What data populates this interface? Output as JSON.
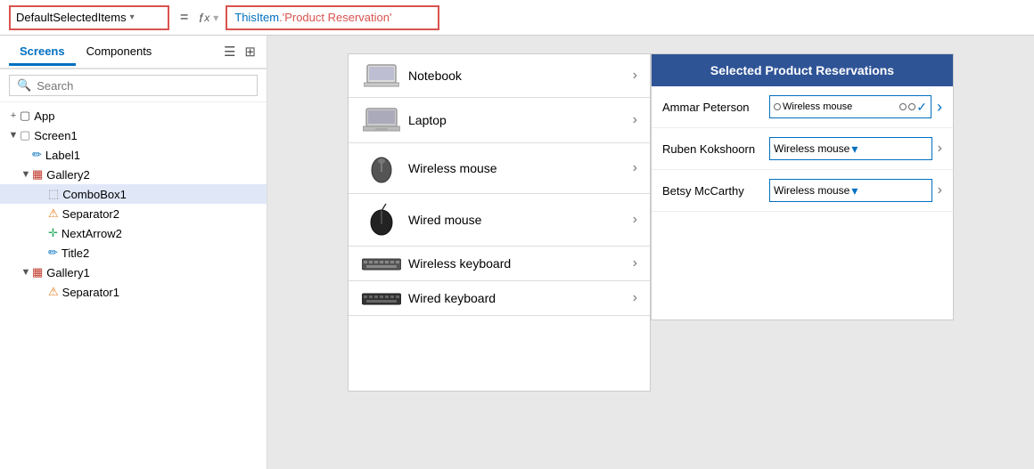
{
  "formulaBar": {
    "dropdownLabel": "DefaultSelectedItems",
    "equals": "=",
    "fx": "fx",
    "formulaText": "ThisItem.'Product Reservation'"
  },
  "sidebar": {
    "tabs": [
      {
        "id": "screens",
        "label": "Screens",
        "active": true
      },
      {
        "id": "components",
        "label": "Components",
        "active": false
      }
    ],
    "searchPlaceholder": "Search",
    "tree": [
      {
        "id": "app",
        "label": "App",
        "indent": 0,
        "expand": "+",
        "iconType": "app"
      },
      {
        "id": "screen1",
        "label": "Screen1",
        "indent": 0,
        "expand": "▲",
        "iconType": "screen"
      },
      {
        "id": "label1",
        "label": "Label1",
        "indent": 1,
        "expand": "",
        "iconType": "label"
      },
      {
        "id": "gallery2",
        "label": "Gallery2",
        "indent": 1,
        "expand": "▲",
        "iconType": "gallery"
      },
      {
        "id": "combobox1",
        "label": "ComboBox1",
        "indent": 2,
        "expand": "",
        "iconType": "combobox",
        "selected": true
      },
      {
        "id": "separator2",
        "label": "Separator2",
        "indent": 2,
        "expand": "",
        "iconType": "separator"
      },
      {
        "id": "nextarrow2",
        "label": "NextArrow2",
        "indent": 2,
        "expand": "",
        "iconType": "nextarrow"
      },
      {
        "id": "title2",
        "label": "Title2",
        "indent": 2,
        "expand": "",
        "iconType": "title"
      },
      {
        "id": "gallery1",
        "label": "Gallery1",
        "indent": 1,
        "expand": "▲",
        "iconType": "gallery"
      },
      {
        "id": "separator1",
        "label": "Separator1",
        "indent": 2,
        "expand": "",
        "iconType": "separator"
      }
    ]
  },
  "productList": {
    "items": [
      {
        "id": "notebook",
        "name": "Notebook",
        "iconType": "notebook"
      },
      {
        "id": "laptop",
        "name": "Laptop",
        "iconType": "laptop"
      },
      {
        "id": "wireless-mouse",
        "name": "Wireless mouse",
        "iconType": "wireless-mouse"
      },
      {
        "id": "wired-mouse",
        "name": "Wired mouse",
        "iconType": "wired-mouse"
      },
      {
        "id": "wireless-keyboard",
        "name": "Wireless keyboard",
        "iconType": "wireless-keyboard"
      },
      {
        "id": "wired-keyboard",
        "name": "Wired keyboard",
        "iconType": "wired-keyboard"
      }
    ]
  },
  "reservationsPanel": {
    "title": "Selected Product Reservations",
    "rows": [
      {
        "id": "ammar",
        "name": "Ammar Peterson",
        "selection": "Wireless mouse",
        "special": true
      },
      {
        "id": "ruben",
        "name": "Ruben Kokshoorn",
        "selection": "Wireless mouse",
        "special": false
      },
      {
        "id": "betsy",
        "name": "Betsy McCarthy",
        "selection": "Wireless mouse",
        "special": false
      }
    ]
  },
  "icons": {
    "chevronRight": "›",
    "chevronDown": "⌄",
    "searchIcon": "🔍",
    "expandOpen": "▲",
    "expandClosed": "▶"
  }
}
